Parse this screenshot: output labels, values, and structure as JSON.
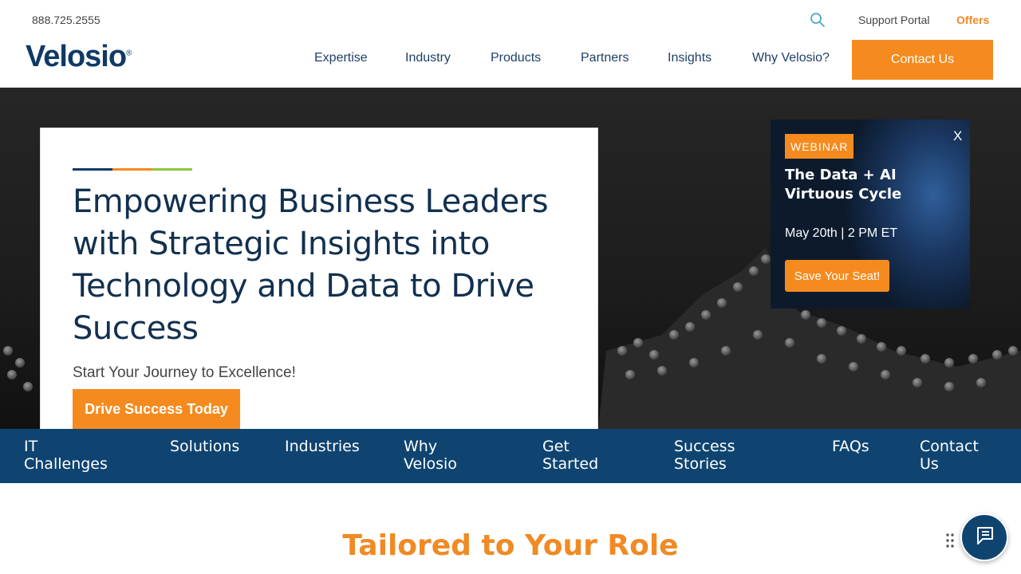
{
  "header": {
    "phone": "888.725.2555",
    "support_label": "Support Portal",
    "offers_label": "Offers",
    "logo_text": "Velosio",
    "nav": [
      "Expertise",
      "Industry",
      "Products",
      "Partners",
      "Insights",
      "Why Velosio?"
    ],
    "contact_label": "Contact Us"
  },
  "hero": {
    "title": "Empowering Business Leaders with Strategic Insights into Technology and Data to Drive Success",
    "subtitle": "Start Your Journey to Excellence!",
    "cta_label": "Drive Success Today",
    "accent_colors": [
      "#0f3a66",
      "#f58b1f",
      "#8dc63f"
    ]
  },
  "webinar": {
    "badge": "WEBINAR",
    "close": "X",
    "title": "The Data + AI Virtuous Cycle",
    "date": "May 20th | 2 PM ET",
    "button_label": "Save Your Seat!"
  },
  "subnav": {
    "items": [
      "IT Challenges",
      "Solutions",
      "Industries",
      "Why Velosio",
      "Get Started",
      "Success Stories",
      "FAQs",
      "Contact Us"
    ]
  },
  "section": {
    "title": "Tailored to Your Role"
  },
  "colors": {
    "brand_blue": "#0f4470",
    "accent_orange": "#f58b1f"
  },
  "icons": {
    "search": "search-icon",
    "chat": "chat-icon",
    "drag": "drag-handle-icon"
  }
}
